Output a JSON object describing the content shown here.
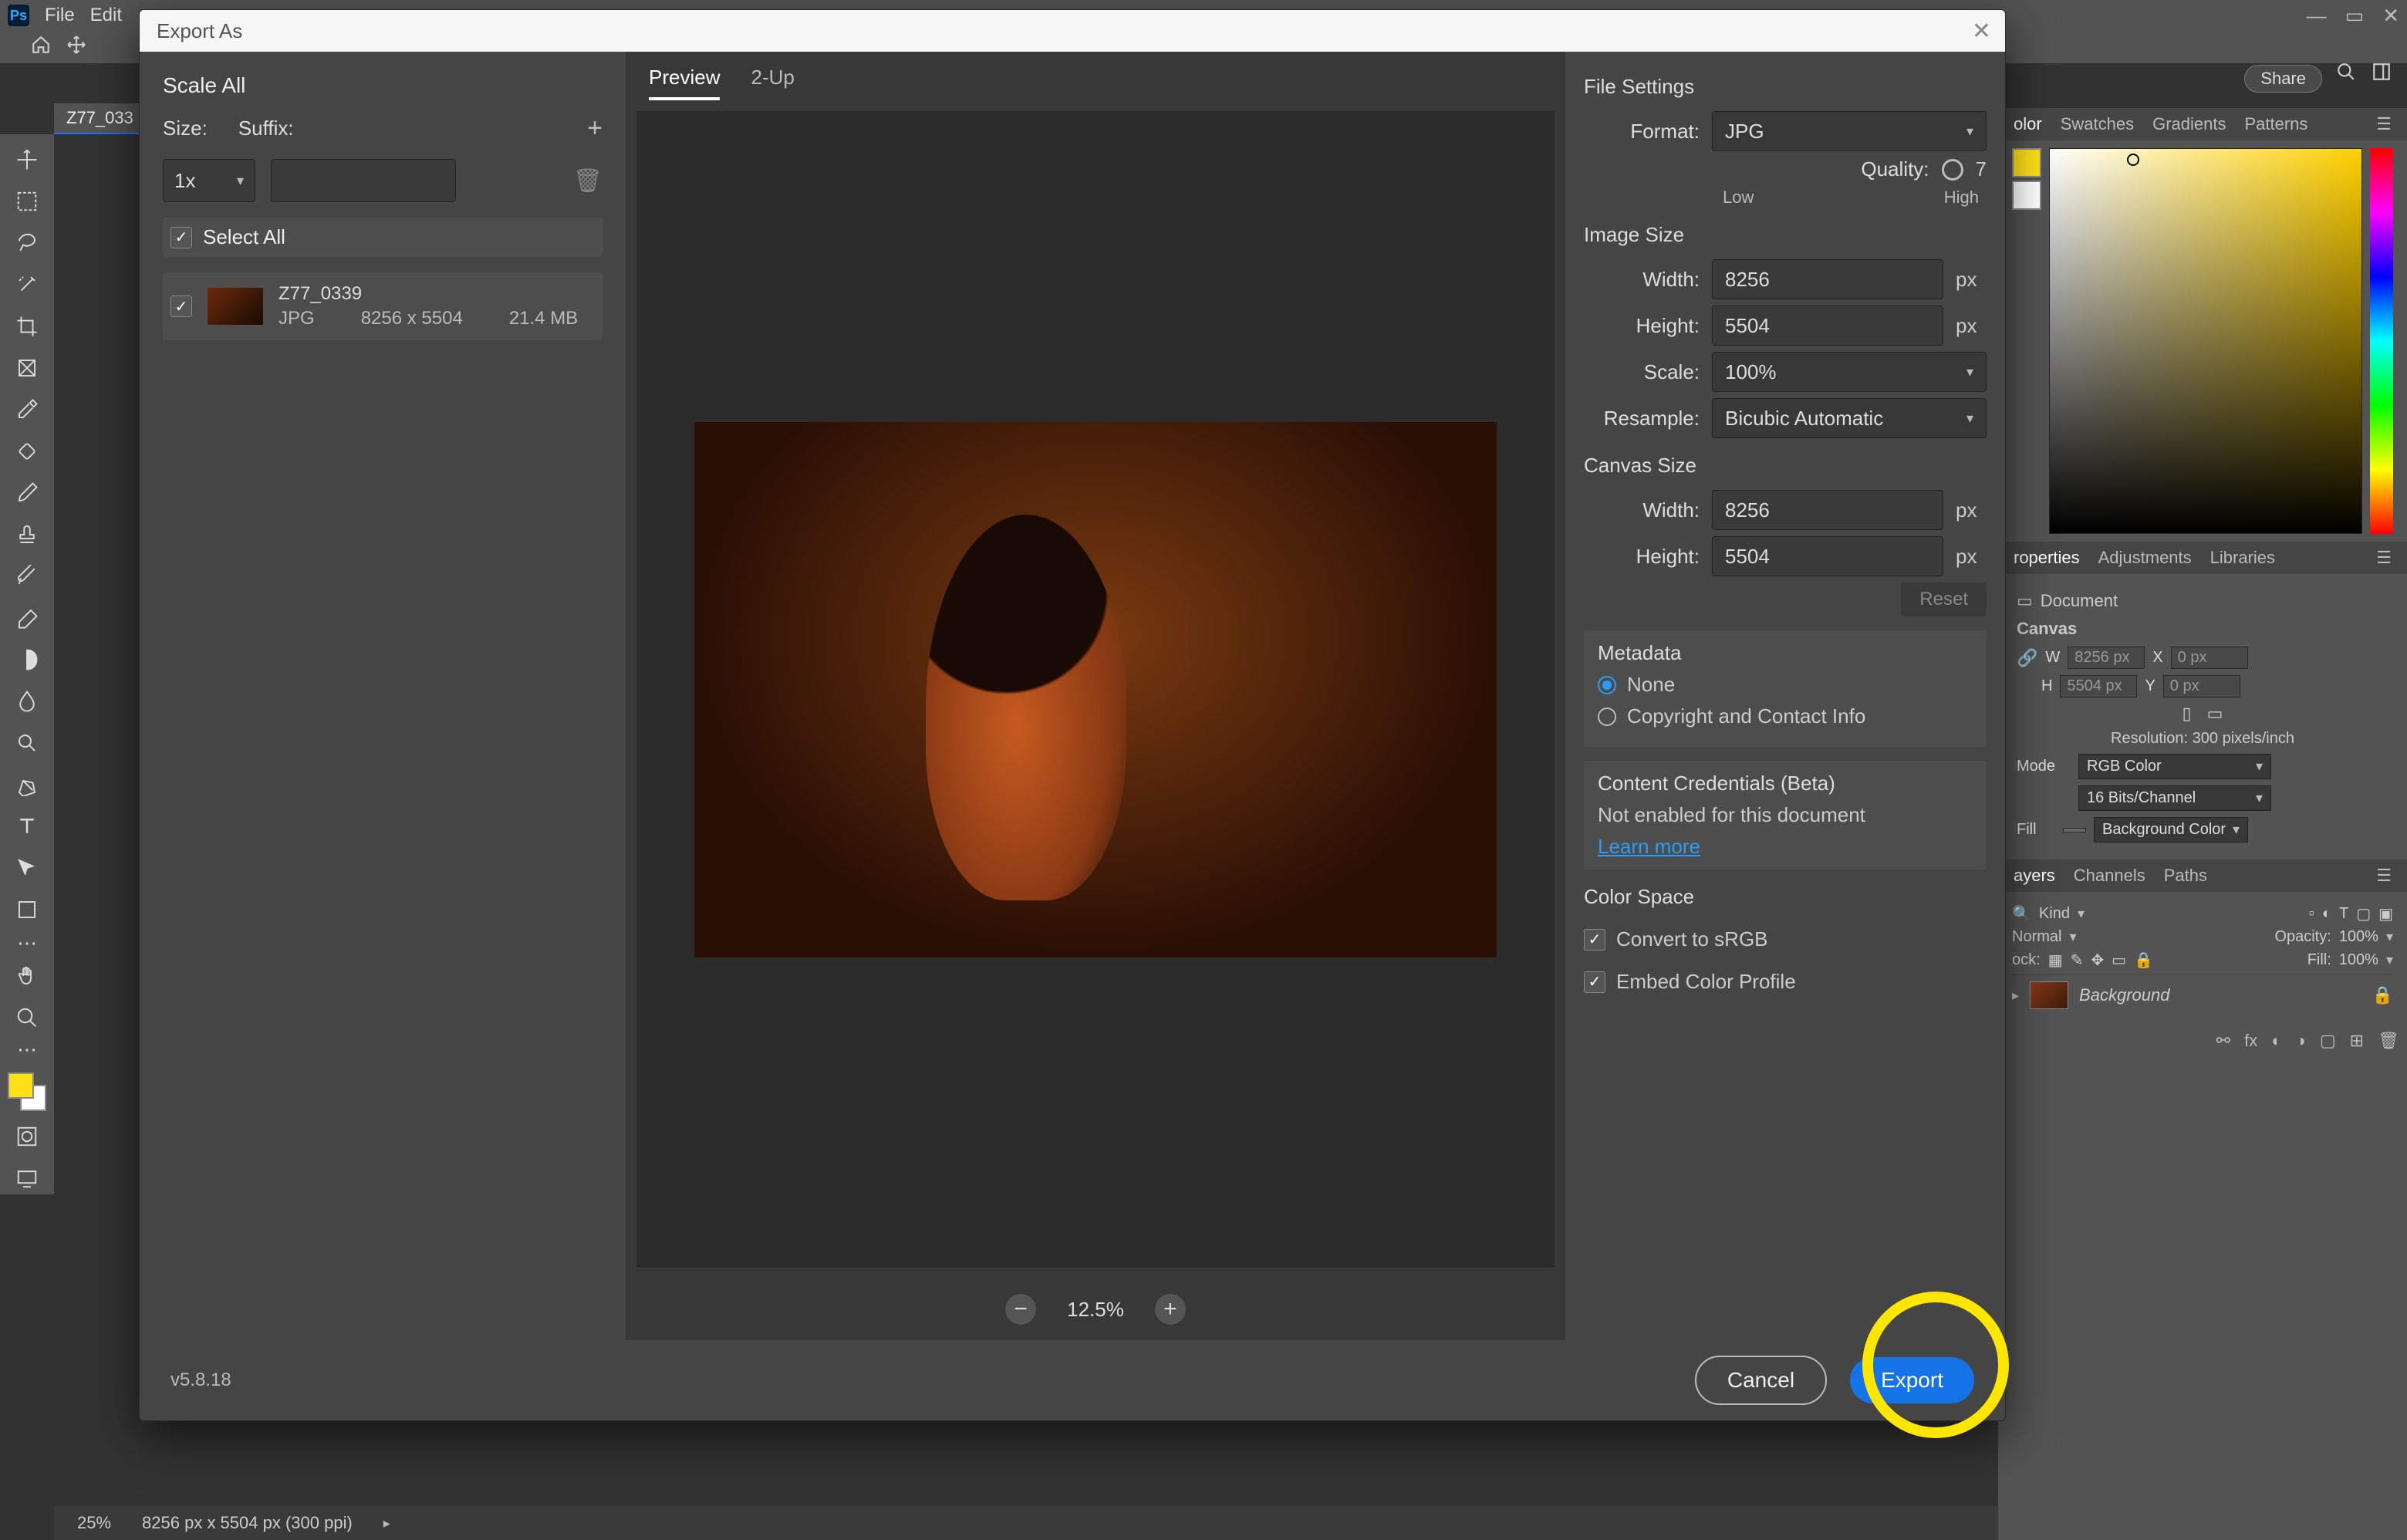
{
  "menu": {
    "file": "File",
    "edit": "Edit"
  },
  "share": "Share",
  "doc_tab": "Z77_033",
  "status": {
    "zoom": "25%",
    "info": "8256 px x 5504 px (300 ppi)"
  },
  "panels": {
    "color_tabs": [
      "olor",
      "Swatches",
      "Gradients",
      "Patterns"
    ],
    "prop_tabs": [
      "roperties",
      "Adjustments",
      "Libraries"
    ],
    "layer_tabs": [
      "ayers",
      "Channels",
      "Paths"
    ],
    "properties": {
      "doc_label": "Document",
      "canvas_label": "Canvas",
      "w_label": "W",
      "w_val": "8256 px",
      "h_label": "H",
      "h_val": "5504 px",
      "x_label": "X",
      "x_val": "0 px",
      "y_label": "Y",
      "y_val": "0 px",
      "resolution": "Resolution: 300 pixels/inch",
      "mode_label": "Mode",
      "mode_val": "RGB Color",
      "bits_val": "16 Bits/Channel",
      "fill_label": "Fill",
      "bgcolor_label": "Background Color"
    },
    "layers": {
      "kind": "Kind",
      "blend": "Normal",
      "opacity_label": "Opacity:",
      "opacity_val": "100%",
      "lock_label": "ock:",
      "fill_label": "Fill:",
      "fill_val": "100%",
      "bg_layer": "Background"
    }
  },
  "dialog": {
    "title": "Export As",
    "scale_all": "Scale All",
    "size_label": "Size:",
    "suffix_label": "Suffix:",
    "size_val": "1x",
    "select_all": "Select All",
    "asset": {
      "name": "Z77_0339",
      "fmt": "JPG",
      "dims": "8256 x 5504",
      "size": "21.4 MB"
    },
    "mid_tabs": {
      "preview": "Preview",
      "twoup": "2-Up"
    },
    "zoom_val": "12.5%",
    "settings": {
      "file_settings": "File Settings",
      "format_label": "Format:",
      "format_val": "JPG",
      "quality_label": "Quality:",
      "quality_val": "7",
      "low": "Low",
      "high": "High",
      "image_size": "Image Size",
      "width_label": "Width:",
      "width_val": "8256",
      "height_label": "Height:",
      "height_val": "5504",
      "scale_label": "Scale:",
      "scale_val": "100%",
      "resample_label": "Resample:",
      "resample_val": "Bicubic Automatic",
      "canvas_size": "Canvas Size",
      "c_width_val": "8256",
      "c_height_val": "5504",
      "px": "px",
      "reset": "Reset",
      "metadata": "Metadata",
      "meta_none": "None",
      "meta_copyright": "Copyright and Contact Info",
      "cc_title": "Content Credentials (Beta)",
      "cc_text": "Not enabled for this document",
      "learn_more": "Learn more",
      "color_space": "Color Space",
      "convert_srgb": "Convert to sRGB",
      "embed_profile": "Embed Color Profile"
    },
    "footer": {
      "version": "v5.8.18",
      "cancel": "Cancel",
      "export": "Export"
    }
  }
}
